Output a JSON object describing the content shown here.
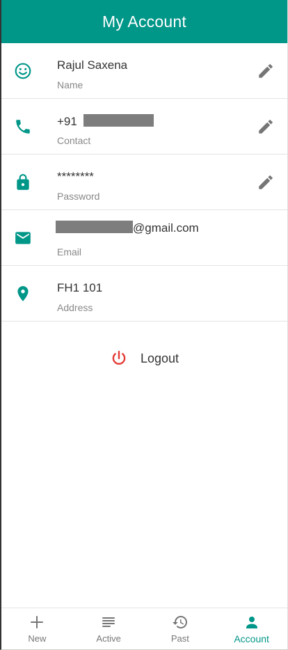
{
  "app": {
    "title": "My Account",
    "accent": "#009688",
    "danger": "#e53935"
  },
  "rows": [
    {
      "icon": "smiley-face-icon",
      "value": "Rajul Saxena",
      "label": "Name",
      "editable": true
    },
    {
      "icon": "phone-icon",
      "value_prefix": "+91",
      "label": "Contact",
      "editable": true,
      "redacted": true
    },
    {
      "icon": "lock-icon",
      "value": "********",
      "label": "Password",
      "editable": true
    },
    {
      "icon": "mail-icon",
      "value_suffix": "@gmail.com",
      "label": "Email",
      "editable": false,
      "redacted": true
    },
    {
      "icon": "location-pin-icon",
      "value": "FH1 101",
      "label": "Address",
      "editable": false
    }
  ],
  "logout": {
    "label": "Logout",
    "icon": "power-icon"
  },
  "bottom_nav": [
    {
      "label": "New",
      "icon": "plus-icon",
      "active": false
    },
    {
      "label": "Active",
      "icon": "list-lines-icon",
      "active": false
    },
    {
      "label": "Past",
      "icon": "history-icon",
      "active": false
    },
    {
      "label": "Account",
      "icon": "person-icon",
      "active": true
    }
  ]
}
